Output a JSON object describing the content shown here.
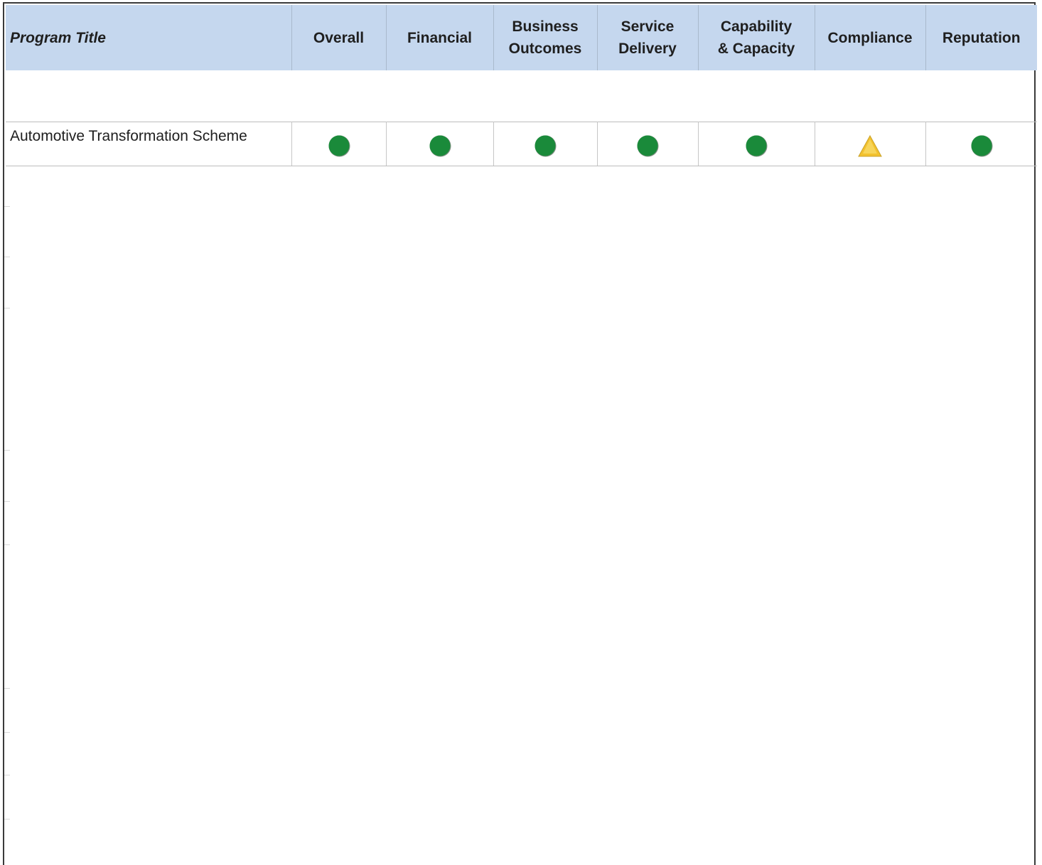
{
  "table": {
    "headers": {
      "program_title": "Program Title",
      "overall": "Overall",
      "financial": "Financial",
      "business_outcomes_line1": "Business",
      "business_outcomes_line2": "Outcomes",
      "service_delivery_line1": "Service",
      "service_delivery_line2": "Delivery",
      "capability_line1": "Capability",
      "capability_line2": "& Capacity",
      "compliance": "Compliance",
      "reputation": "Reputation"
    },
    "rows": [
      {
        "program": "Automotive Transformation Scheme",
        "overall": "green-circle",
        "financial": "green-circle",
        "business_outcomes": "green-circle",
        "service_delivery": "green-circle",
        "capability_capacity": "green-circle",
        "compliance": "amber-triangle",
        "reputation": "green-circle"
      }
    ]
  },
  "colors": {
    "header_bg": "#c5d7ee",
    "status_green": "#1a8a3a",
    "status_amber": "#f2c12e"
  }
}
